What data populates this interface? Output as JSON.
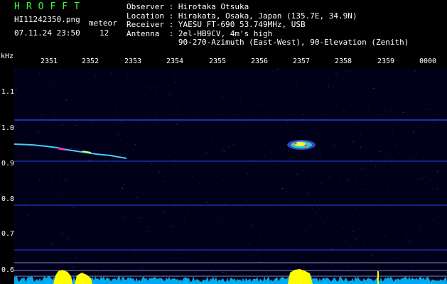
{
  "header": {
    "app_title": "HROFFT",
    "filename": "HI11242350.png",
    "datetime": "07.11.24 23:50",
    "meteor_label": "meteor",
    "meteor_count": "12"
  },
  "info": {
    "observer": "Observer : Hirotaka Otsuka",
    "location": "Location : Hirakata, Osaka, Japan (135.7E, 34.9N)",
    "receiver": "Receiver : YAESU FT-690 53.749MHz, USB",
    "antenna": "Antenna  : 2el-HB9CV, 4m's high",
    "antenna2": "           90-270-Azimuth (East-West), 90-Elevation (Zenith)"
  },
  "axes": {
    "y_unit": "kHz",
    "x_ticks": [
      "2351",
      "2352",
      "2353",
      "2354",
      "2355",
      "2356",
      "2357",
      "2358",
      "2359",
      "0000"
    ],
    "y_ticks": [
      "1.1",
      "1.0",
      "0.9",
      "0.8",
      "0.7",
      "0.6"
    ]
  },
  "colors": {
    "background": "#000000",
    "header_text": "#33ff33",
    "label_text": "#ffffff",
    "activity_bar": "#ffff00",
    "noise_floor": "#00ccff",
    "band_line": "#2233cc"
  }
}
